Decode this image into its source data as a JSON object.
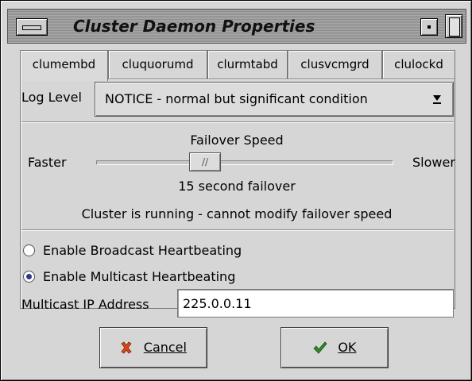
{
  "window": {
    "title": "Cluster Daemon Properties"
  },
  "tabs": [
    {
      "label": "clumembd",
      "active": true
    },
    {
      "label": "cluquorumd",
      "active": false
    },
    {
      "label": "clurmtabd",
      "active": false
    },
    {
      "label": "clusvcmgrd",
      "active": false
    },
    {
      "label": "clulockd",
      "active": false
    }
  ],
  "log_level": {
    "label": "Log Level",
    "value": "NOTICE - normal but significant condition"
  },
  "failover": {
    "title": "Failover Speed",
    "min_label": "Faster",
    "max_label": "Slower",
    "thumb_glyph": "//",
    "slider_fraction": 0.35,
    "value_text": "15 second failover",
    "status_text": "Cluster is running - cannot modify failover speed"
  },
  "heartbeat": {
    "broadcast_label": "Enable Broadcast Heartbeating",
    "multicast_label": "Enable Multicast Heartbeating",
    "selected": "multicast"
  },
  "multicast": {
    "label": "Multicast IP Address",
    "value": "225.0.0.11"
  },
  "buttons": {
    "cancel": {
      "label": "Cancel",
      "icon": "x-icon",
      "color": "#d9481a"
    },
    "ok": {
      "label": "OK",
      "icon": "checkmark-icon",
      "color": "#2e8b2e"
    }
  }
}
